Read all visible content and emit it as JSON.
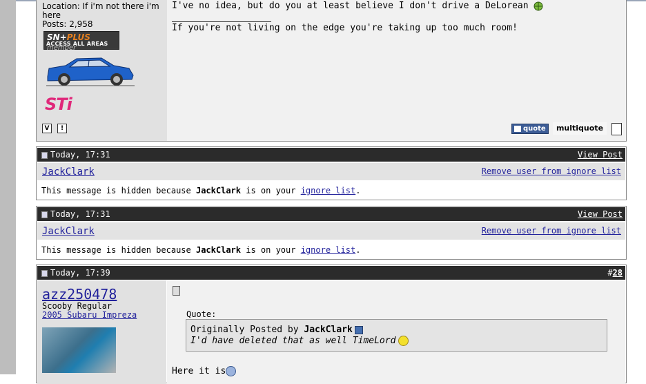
{
  "post_top": {
    "user_location": "Location: If i'm not there i'm here",
    "user_posts": "Posts: 2,958",
    "badge": {
      "brand": "SN+",
      "plus": "PLUS",
      "member": "member",
      "tagline": "ACCESS ALL AREAS"
    },
    "badge_sti": "STi",
    "message": "I've no idea, but do you at least believe I don't drive a DeLorean",
    "signature": "If you're not living on the edge you're taking up too much room!",
    "quote_label": "quote",
    "multiquote_label": "multiquote",
    "icons": [
      "v-icon",
      "profile-icon",
      "globe-icon",
      "multiquote-icon"
    ]
  },
  "ignored_posts": [
    {
      "date": "Today, 17:31",
      "view_post": "View Post",
      "user": "JackClark",
      "remove": "Remove user from ignore list",
      "msg_pre": "This message is hidden because ",
      "msg_user": "JackClark",
      "msg_mid": " is on your ",
      "msg_link": "ignore list",
      "msg_end": "."
    },
    {
      "date": "Today, 17:31",
      "view_post": "View Post",
      "user": "JackClark",
      "remove": "Remove user from ignore list",
      "msg_pre": "This message is hidden because ",
      "msg_user": "JackClark",
      "msg_mid": " is on your ",
      "msg_link": "ignore list",
      "msg_end": "."
    }
  ],
  "post28": {
    "date": "Today, 17:39",
    "hash": "#",
    "number": "28",
    "username": "azz250478",
    "user_title": "Scooby Regular",
    "user_car": "2005 Subaru Impreza",
    "quote_label": "Quote:",
    "quote_origin_pre": "Originally Posted by ",
    "quote_origin_user": "JackClark",
    "quote_text": "I'd have deleted that as well TimeLord",
    "body_start": "Here it is"
  },
  "colors": {
    "bar": "#2b2b2b",
    "link": "#22229c",
    "panel": "#e1e1e1",
    "quote_button": "#3d5d96",
    "sti_pink": "#e0287a"
  }
}
